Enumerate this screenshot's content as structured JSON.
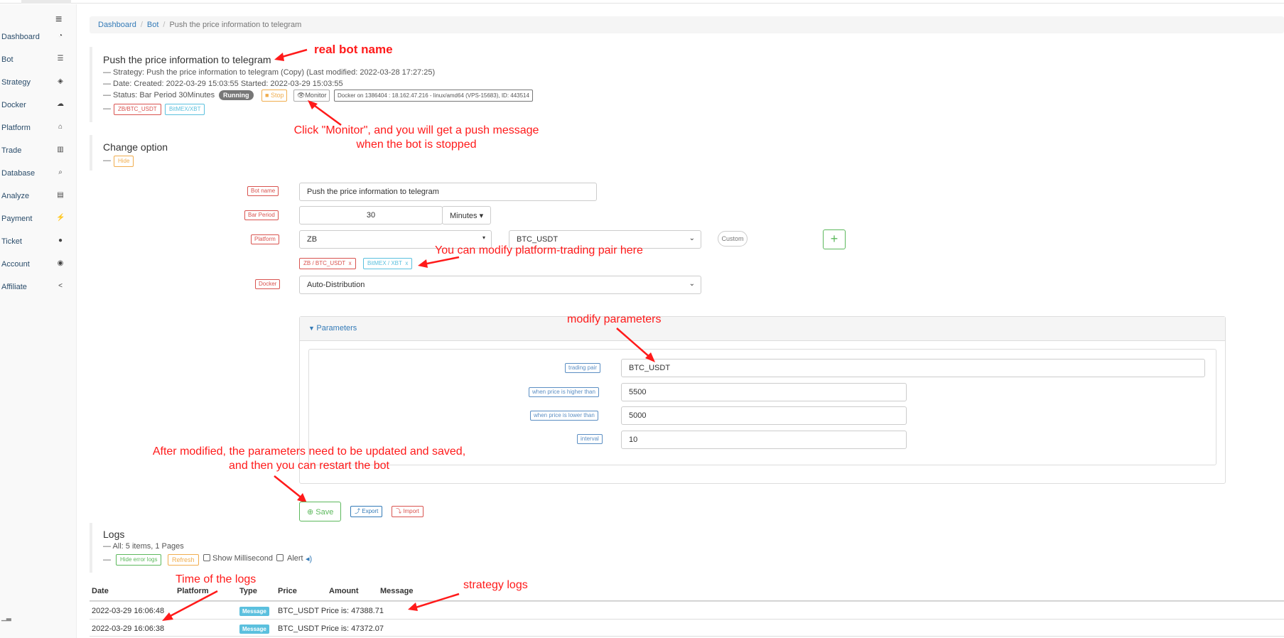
{
  "sidebar": {
    "menu_icon": "hamburger-icon",
    "items": [
      {
        "label": "Dashboard",
        "icon": "dashboard-icon"
      },
      {
        "label": "Bot",
        "icon": "list-icon"
      },
      {
        "label": "Strategy",
        "icon": "cube-icon"
      },
      {
        "label": "Docker",
        "icon": "cloud-icon"
      },
      {
        "label": "Platform",
        "icon": "bank-icon"
      },
      {
        "label": "Trade",
        "icon": "chart-icon"
      },
      {
        "label": "Database",
        "icon": "search-icon"
      },
      {
        "label": "Analyze",
        "icon": "calculator-icon"
      },
      {
        "label": "Payment",
        "icon": "plug-icon"
      },
      {
        "label": "Ticket",
        "icon": "comment-icon"
      },
      {
        "label": "Account",
        "icon": "user-circle-icon"
      },
      {
        "label": "Affiliate",
        "icon": "share-icon"
      }
    ]
  },
  "breadcrumb": {
    "home": "Dashboard",
    "section": "Bot",
    "current": "Push the price information to telegram",
    "sep": "/"
  },
  "bot": {
    "title": "Push the price information to telegram",
    "strategy_line": "— Strategy: Push the price information to telegram (Copy)  (Last modified: 2022-03-28 17:27:25)",
    "date_line": "— Date: Created: 2022-03-29 15:03:55 Started: 2022-03-29 15:03:55",
    "status_line": "— Status: Bar Period 30Minutes",
    "running": "Running",
    "stop": "Stop",
    "monitor": "Monitor",
    "docker_info": "Docker on 1386404 : 18.162.47.216 - linux/amd64 (VPS-15683), ID: 443514",
    "dash": "—",
    "pair_tags": [
      "ZB/BTC_USDT",
      "BitMEX/XBT"
    ]
  },
  "change": {
    "title": "Change option",
    "dash": "—",
    "hide": "Hide"
  },
  "form": {
    "bot_name_label": "Bot name",
    "bot_name_value": "Push the price information to telegram",
    "bar_period_label": "Bar Period",
    "bar_period_value": "30",
    "bar_period_unit": "Minutes ▾",
    "platform_label": "Platform",
    "platform_value": "ZB",
    "pair_value": "BTC_USDT",
    "custom": "Custom",
    "add": "+",
    "pairs": [
      "ZB / BTC_USDT",
      "BitMEX / XBT"
    ],
    "remove": "x",
    "docker_label": "Docker",
    "docker_value": "Auto-Distribution"
  },
  "parameters": {
    "title": "Parameters",
    "rows": [
      {
        "label": "trading pair",
        "value": "BTC_USDT"
      },
      {
        "label": "when price is higher than",
        "value": "5500"
      },
      {
        "label": "when price is lower than",
        "value": "5000"
      },
      {
        "label": "interval",
        "value": "10"
      }
    ]
  },
  "actions": {
    "save": "Save",
    "export": "Export",
    "import": "Import"
  },
  "logs": {
    "title": "Logs",
    "summary": "— All: 5 items, 1 Pages",
    "dash": "—",
    "hide_error": "Hide error logs",
    "refresh": "Refresh",
    "show_ms": "Show Millisecond",
    "alert": "Alert",
    "columns": [
      "Date",
      "Platform",
      "Type",
      "Price",
      "Amount",
      "Message"
    ],
    "rows": [
      {
        "date": "2022-03-29 16:06:48",
        "type": "Message",
        "message": "BTC_USDT Price is: 47388.71"
      },
      {
        "date": "2022-03-29 16:06:38",
        "type": "Message",
        "message": "BTC_USDT Price is: 47372.07"
      }
    ]
  },
  "annotations": {
    "real_bot_name": "real bot name",
    "monitor_1": "Click \"Monitor\", and you will get a push message",
    "monitor_2": "when the bot is stopped",
    "pair_hint": "You can modify platform-trading pair here",
    "modify_params": "modify parameters",
    "save_1": "After modified, the parameters need to be updated and saved,",
    "save_2": "and then you can restart the bot",
    "time_logs": "Time of the logs",
    "strategy_logs": "strategy logs"
  },
  "colors": {
    "accent": "#337ab7",
    "annotation": "#ff1a1a",
    "success": "#5cb85c",
    "danger": "#d9534f",
    "info": "#5bc0de"
  }
}
